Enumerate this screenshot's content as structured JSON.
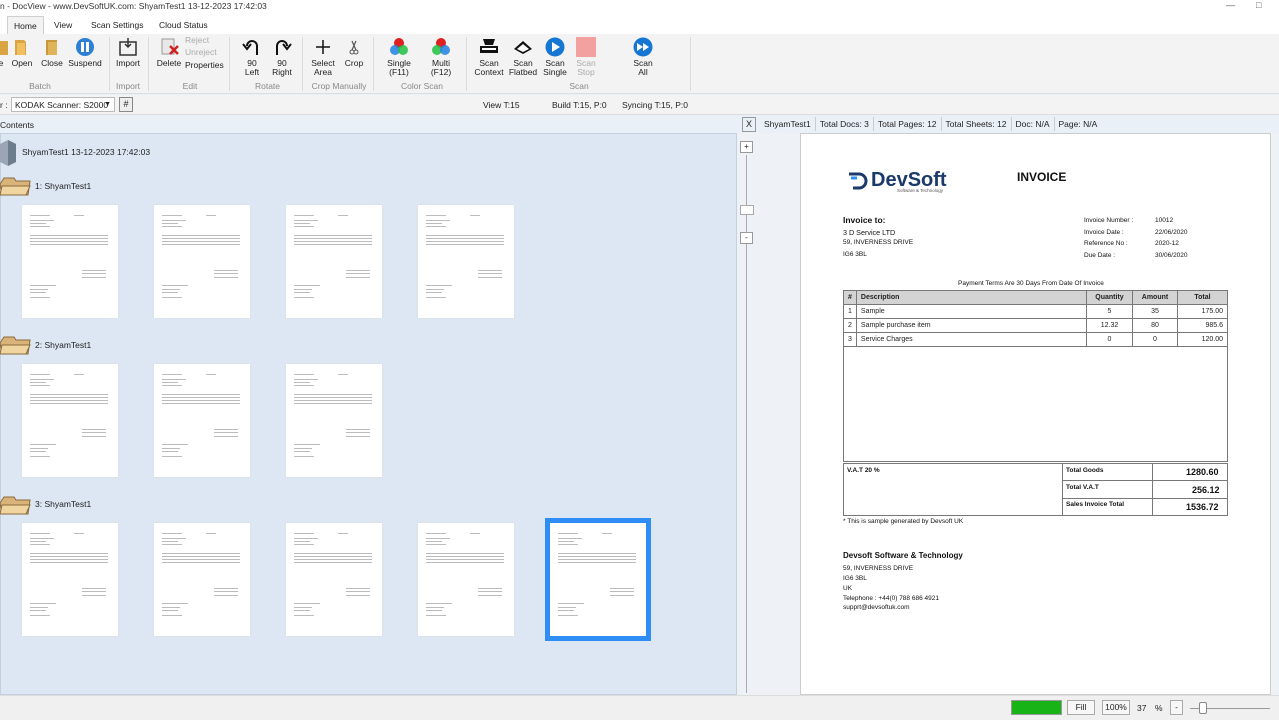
{
  "window": {
    "title": "n - DocView - www.DevSoftUK.com: ShyamTest1 13-12-2023 17:42:03"
  },
  "tabs": [
    "Home",
    "View",
    "Scan Settings",
    "Cloud Status"
  ],
  "ribbon": {
    "open": "Open",
    "close": "Close",
    "suspend": "Suspend",
    "import": "Import",
    "reject": "Reject",
    "unreject": "Unreject",
    "delete": "Delete",
    "properties": "Properties",
    "rot_left": [
      "90",
      "Left"
    ],
    "rot_right": [
      "90",
      "Right"
    ],
    "select_area": [
      "Select",
      "Area"
    ],
    "crop": "Crop",
    "single": [
      "Single",
      "(F11)"
    ],
    "multi": [
      "Multi",
      "(F12)"
    ],
    "scan_context": [
      "Scan",
      "Context"
    ],
    "scan_flatbed": [
      "Scan",
      "Flatbed"
    ],
    "scan_single": [
      "Scan",
      "Single"
    ],
    "scan_stop": [
      "Scan",
      "Stop"
    ],
    "scan_all": [
      "Scan",
      "All"
    ],
    "groups": {
      "batch": "Batch",
      "import": "Import",
      "edit": "Edit",
      "rotate": "Rotate",
      "crop": "Crop Manually",
      "color": "Color Scan",
      "scan": "Scan"
    }
  },
  "status": {
    "scanner_label": "r :",
    "scanner": "KODAK Scanner: S2000",
    "hash": "#",
    "view": "View T:15",
    "build": "Build T:15, P:0",
    "sync": "Syncing T:15, P:0"
  },
  "contents": {
    "label": "Contents",
    "root": "ShyamTest1 13-12-2023 17:42:03",
    "batches": [
      "1: ShyamTest1",
      "2: ShyamTest1",
      "3: ShyamTest1"
    ]
  },
  "info": {
    "x": "X",
    "name": "ShyamTest1",
    "docs": "Total Docs: 3",
    "pages": "Total Pages: 12",
    "sheets": "Total Sheets: 12",
    "doc": "Doc: N/A",
    "page": "Page: N/A"
  },
  "scrollbtns": {
    "plus": "+",
    "minus": "-"
  },
  "invoice": {
    "logo": "DevSoft",
    "logo_sub": "Software & Technology",
    "title": "INVOICE",
    "to_label": "Invoice to:",
    "to_lines": [
      "3 D Service LTD",
      "59, INVERNESS DRIVE",
      "IG6 3BL"
    ],
    "meta_labels": [
      "Invoice Number :",
      "Invoice Date :",
      "Reference No :",
      "Due Date :"
    ],
    "meta_values": [
      "10012",
      "22/06/2020",
      "2020-12",
      "30/06/2020"
    ],
    "terms": "Payment Terms Are 30 Days From Date Of Invoice",
    "headers": [
      "#",
      "Description",
      "Quantity",
      "Amount",
      "Total"
    ],
    "rows": [
      [
        "1",
        "Sample",
        "5",
        "35",
        "175.00"
      ],
      [
        "2",
        "Sample purchase item",
        "12.32",
        "80",
        "985.6"
      ],
      [
        "3",
        "Service Charges",
        "0",
        "0",
        "120.00"
      ]
    ],
    "vat_label": "V.A.T 20 %",
    "totals": [
      [
        "Total Goods",
        "1280.60"
      ],
      [
        "Total V.A.T",
        "256.12"
      ],
      [
        "Sales Invoice Total",
        "1536.72"
      ]
    ],
    "note": "* This is sample generated by Devsoft UK",
    "company": "Devsoft Software & Technology",
    "address": [
      "59, INVERNESS DRIVE",
      "IG6 3BL",
      "UK",
      "Telephone : +44(0) 788 686 4921",
      "supprt@devsoftuk.com"
    ]
  },
  "bottom": {
    "fill": "Fill",
    "zoom_btn": "100%",
    "zoom_val": "37",
    "pct": "%",
    "minus": "-"
  },
  "colors": {
    "accent": "#2f8ef5",
    "progress": "#17b317"
  }
}
